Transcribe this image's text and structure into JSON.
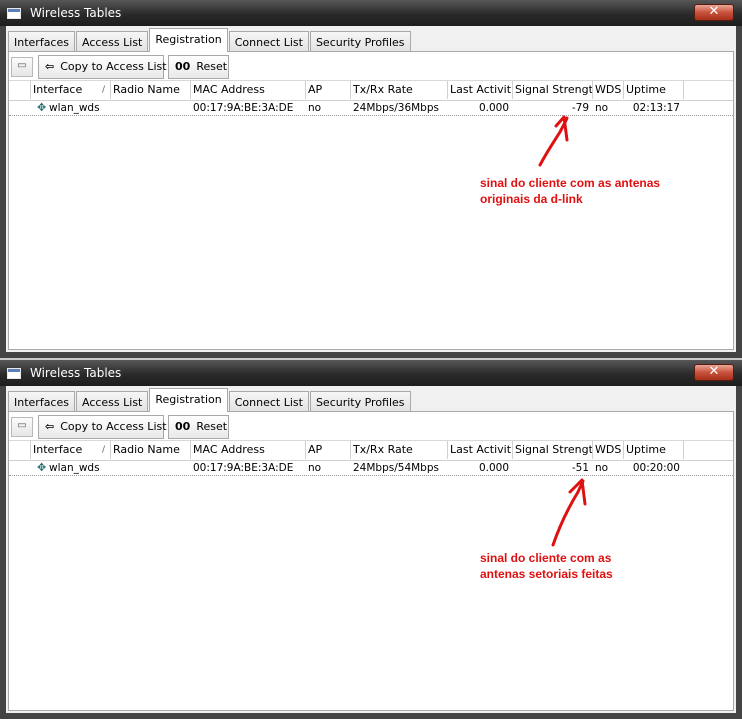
{
  "windows": [
    {
      "title": "Wireless Tables",
      "close_glyph": "✕",
      "tabs": [
        "Interfaces",
        "Access List",
        "Registration",
        "Connect List",
        "Security Profiles"
      ],
      "active_tab": "Registration",
      "toolbar": {
        "copy_label": "Copy to Access List",
        "reset_icon": "00",
        "reset_label": "Reset"
      },
      "columns": [
        "Interface",
        "Radio Name",
        "MAC Address",
        "AP",
        "Tx/Rx Rate",
        "Last Activit...",
        "Signal Strengt...",
        "WDS",
        "Uptime"
      ],
      "rows": [
        {
          "interface": "wlan_wds",
          "radio_name": "",
          "mac": "00:17:9A:BE:3A:DE",
          "ap": "no",
          "rate": "24Mbps/36Mbps",
          "last_activity": "0.000",
          "signal": "-79",
          "wds": "no",
          "uptime": "02:13:17"
        }
      ],
      "annotation": [
        "sinal do cliente com as antenas",
        "originais da d-link"
      ]
    },
    {
      "title": "Wireless Tables",
      "close_glyph": "✕",
      "tabs": [
        "Interfaces",
        "Access List",
        "Registration",
        "Connect List",
        "Security Profiles"
      ],
      "active_tab": "Registration",
      "toolbar": {
        "copy_label": "Copy to Access List",
        "reset_icon": "00",
        "reset_label": "Reset"
      },
      "columns": [
        "Interface",
        "Radio Name",
        "MAC Address",
        "AP",
        "Tx/Rx Rate",
        "Last Activit...",
        "Signal Strengt...",
        "WDS",
        "Uptime"
      ],
      "rows": [
        {
          "interface": "wlan_wds",
          "radio_name": "",
          "mac": "00:17:9A:BE:3A:DE",
          "ap": "no",
          "rate": "24Mbps/54Mbps",
          "last_activity": "0.000",
          "signal": "-51",
          "wds": "no",
          "uptime": "00:20:00"
        }
      ],
      "annotation": [
        "sinal do cliente com as",
        "antenas setoriais feitas"
      ]
    }
  ],
  "icons": {
    "window": "window-icon",
    "close": "close-icon",
    "filter": "filter-icon",
    "copy": "arrow-left-icon",
    "interface": "wireless-interface-icon"
  },
  "colors": {
    "annotation": "#e01010",
    "titlebar": "#2a2a2a",
    "close": "#c8523c"
  }
}
